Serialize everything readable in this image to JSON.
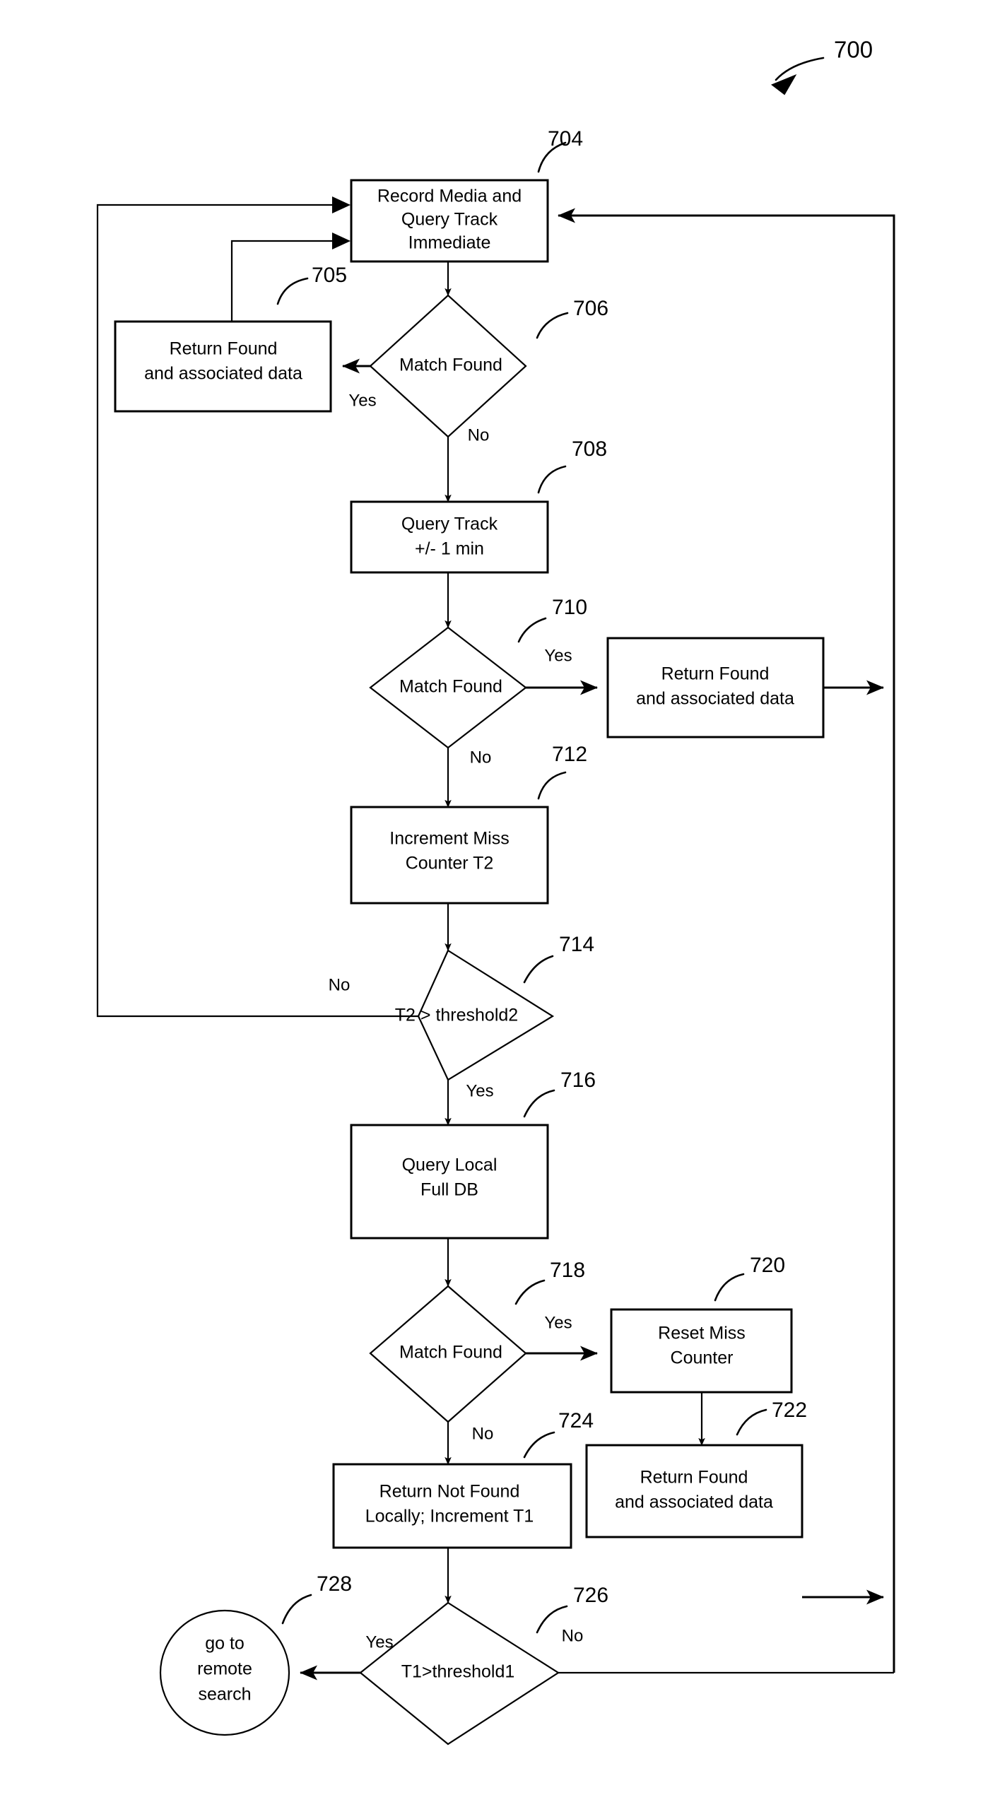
{
  "figure": {
    "number": "700",
    "type": "patent-flowchart"
  },
  "nodes": [
    {
      "id": "704",
      "ref": "704",
      "shape": "process",
      "lines": [
        "Record Media and",
        "Query Track",
        "Immediate"
      ]
    },
    {
      "id": "705",
      "ref": "705",
      "shape": "process",
      "lines": [
        "Return Found",
        "and associated data"
      ]
    },
    {
      "id": "706",
      "ref": "706",
      "shape": "decision",
      "lines": [
        "Match Found"
      ]
    },
    {
      "id": "708",
      "ref": "708",
      "shape": "process",
      "lines": [
        "Query Track",
        "+/- 1 min"
      ]
    },
    {
      "id": "710",
      "ref": "710",
      "shape": "decision",
      "lines": [
        "Match Found"
      ]
    },
    {
      "id": "711",
      "ref": "",
      "shape": "process",
      "lines": [
        "Return Found",
        "and associated data"
      ]
    },
    {
      "id": "712",
      "ref": "712",
      "shape": "process",
      "lines": [
        "Increment Miss",
        "Counter T2"
      ]
    },
    {
      "id": "714",
      "ref": "714",
      "shape": "decision",
      "lines": [
        "T2 > threshold2"
      ]
    },
    {
      "id": "716",
      "ref": "716",
      "shape": "process",
      "lines": [
        "Query Local",
        "Full DB"
      ]
    },
    {
      "id": "718",
      "ref": "718",
      "shape": "decision",
      "lines": [
        "Match Found"
      ]
    },
    {
      "id": "720",
      "ref": "720",
      "shape": "process",
      "lines": [
        "Reset Miss",
        "Counter"
      ]
    },
    {
      "id": "722",
      "ref": "722",
      "shape": "process",
      "lines": [
        "Return Found",
        "and  associated data"
      ]
    },
    {
      "id": "724",
      "ref": "724",
      "shape": "process",
      "lines": [
        "Return Not Found",
        "Locally; Increment T1"
      ]
    },
    {
      "id": "726",
      "ref": "726",
      "shape": "decision",
      "lines": [
        "T1>threshold1"
      ]
    },
    {
      "id": "728",
      "ref": "728",
      "shape": "terminator",
      "lines": [
        "go to",
        "remote",
        "search"
      ]
    }
  ],
  "branch_labels": {
    "d706_yes": "Yes",
    "d706_no": "No",
    "d710_yes": "Yes",
    "d710_no": "No",
    "d714_no": "No",
    "d714_yes": "Yes",
    "d718_yes": "Yes",
    "d718_no": "No",
    "d726_yes": "Yes",
    "d726_no": "No"
  },
  "colors": {
    "stroke": "#000000",
    "fill": "#ffffff",
    "text": "#000000"
  }
}
